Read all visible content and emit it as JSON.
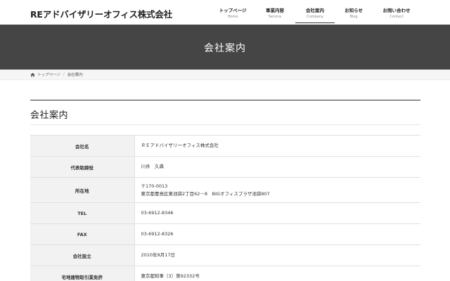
{
  "header": {
    "logo": "REアドバイザリーオフィス株式会社",
    "nav": [
      {
        "jp": "トップページ",
        "en": "Home"
      },
      {
        "jp": "事業内容",
        "en": "Service"
      },
      {
        "jp": "会社案内",
        "en": "Company"
      },
      {
        "jp": "お知らせ",
        "en": "Blog"
      },
      {
        "jp": "お問い合わせ",
        "en": "Contact"
      }
    ],
    "active_nav": "Company"
  },
  "page_title": "会社案内",
  "breadcrumb": {
    "home_icon": "home-icon",
    "home": "トップページ",
    "separator": "/",
    "current": "会社案内"
  },
  "section": {
    "title": "会社案内"
  },
  "company_table": {
    "rows": [
      {
        "label": "会社名",
        "value": "ＲＥアドバイザリーオフィス株式会社"
      },
      {
        "label": "代表取締役",
        "value": "川井　久典"
      },
      {
        "label": "所在地",
        "value_line1": "〒170-0013",
        "value_line2": "東京都豊島区東池袋2丁目62－8　BIGオフィスプラザ池袋807"
      },
      {
        "label": "TEL",
        "value": "03-6912-8346"
      },
      {
        "label": "FAX",
        "value": "03-6912-8326"
      },
      {
        "label": "会社設立",
        "value": "2010年9月17日"
      },
      {
        "label": "宅地建物取引業免許",
        "value": "東京都知事（3）第92332号"
      }
    ]
  },
  "colors": {
    "title_band": "#454545",
    "table_header_bg": "#f2f2f2",
    "breadcrumb_bg": "#f6f6f6"
  }
}
